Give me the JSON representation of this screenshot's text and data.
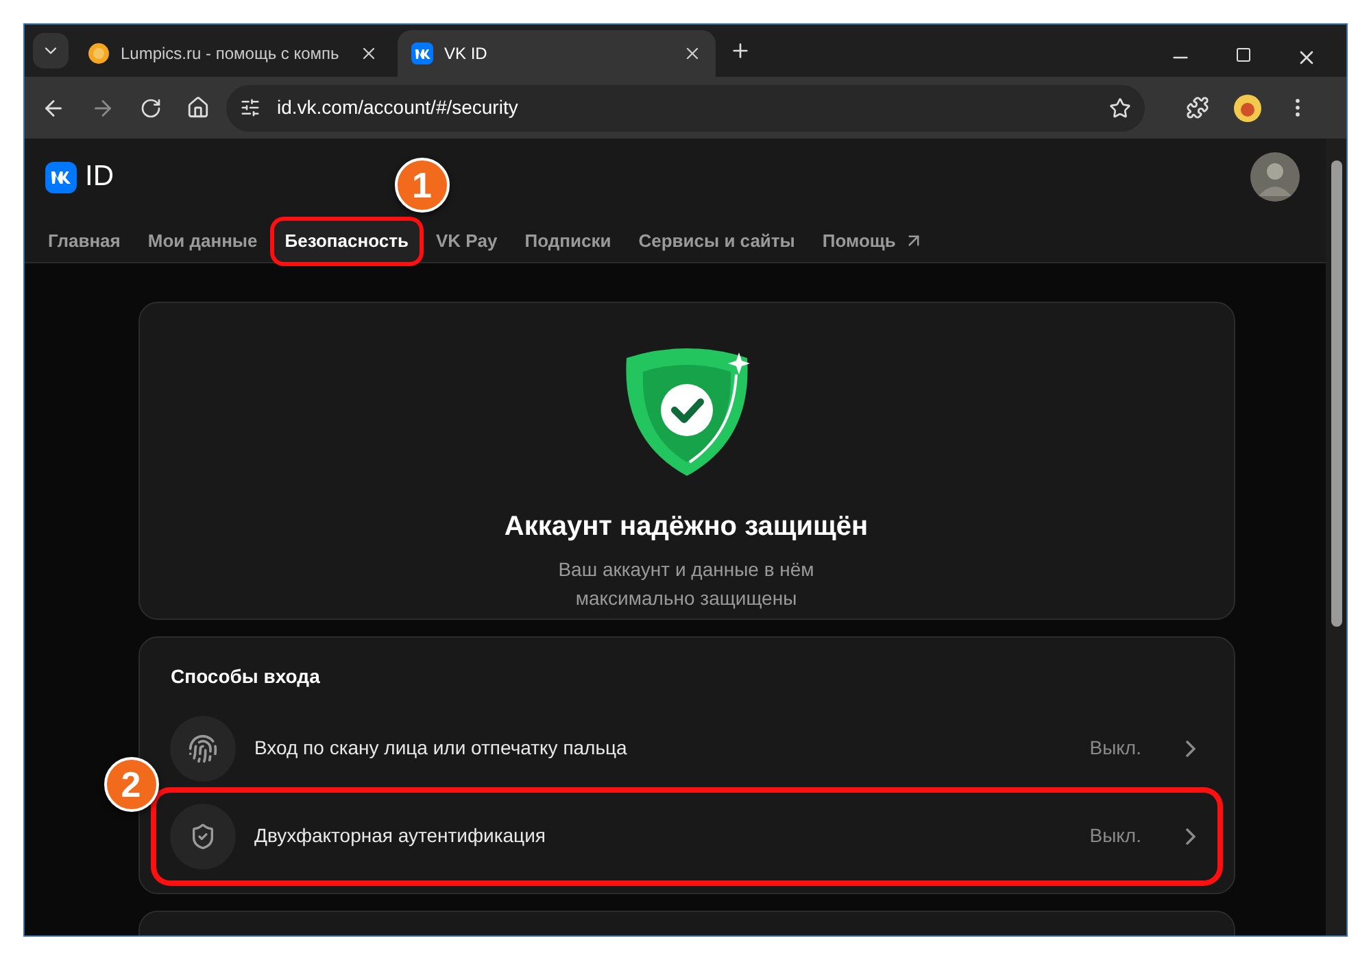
{
  "browser": {
    "tabs": [
      {
        "title": "Lumpics.ru - помощь с компь",
        "kind": "lumpics",
        "selected": false
      },
      {
        "title": "VK ID",
        "kind": "vk",
        "selected": true
      }
    ],
    "address": "id.vk.com/account/#/security"
  },
  "header": {
    "logo_text": "ID",
    "nav": [
      {
        "label": "Главная",
        "selected": false,
        "highlighted": false
      },
      {
        "label": "Мои данные",
        "selected": false,
        "highlighted": false
      },
      {
        "label": "Безопасность",
        "selected": true,
        "highlighted": true,
        "callout": "1"
      },
      {
        "label": "VK Pay",
        "selected": false,
        "highlighted": false
      },
      {
        "label": "Подписки",
        "selected": false,
        "highlighted": false
      },
      {
        "label": "Сервисы и сайты",
        "selected": false,
        "highlighted": false
      },
      {
        "label": "Помощь",
        "selected": false,
        "highlighted": false,
        "external": true
      }
    ]
  },
  "status_card": {
    "title": "Аккаунт надёжно защищён",
    "subtitle": "Ваш аккаунт и данные в нём",
    "subtitle_line_2": "максимально защищены"
  },
  "login_methods": {
    "title": "Способы входа",
    "items": [
      {
        "label": "Вход по скану лица или отпечатку пальца",
        "kind": "fingerprint",
        "value": "Выкл.",
        "highlighted": false
      },
      {
        "label": "Двухфакторная аутентификация",
        "kind": "shield",
        "value": "Выкл.",
        "highlighted": true,
        "callout": "2"
      }
    ]
  }
}
